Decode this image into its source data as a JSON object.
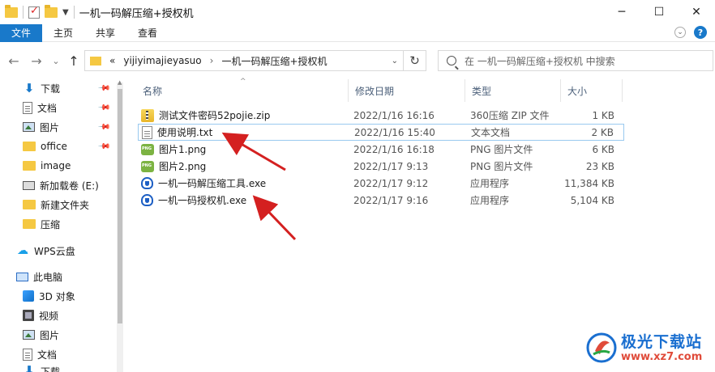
{
  "window": {
    "title": "一机一码解压缩+授权机",
    "controls": {
      "minimize": "─",
      "maximize": "☐",
      "close": "✕"
    }
  },
  "ribbon": {
    "tabs": [
      "文件",
      "主页",
      "共享",
      "查看"
    ],
    "expand": "⌄",
    "help": "?"
  },
  "addressbar": {
    "back": "←",
    "forward": "→",
    "recent": "⌄",
    "up": "↑",
    "overflow": "«",
    "crumbs": [
      "yijiyimajieyasuo",
      "一机一码解压缩+授权机"
    ],
    "separator": "›",
    "dropdown": "⌄",
    "refresh": "↻",
    "search_placeholder": "在 一机一码解压缩+授权机 中搜索"
  },
  "sidebar": {
    "items": [
      {
        "label": "下载",
        "icon": "download-icon",
        "pinned": true
      },
      {
        "label": "文档",
        "icon": "document-icon",
        "pinned": true
      },
      {
        "label": "图片",
        "icon": "picture-icon",
        "pinned": true
      },
      {
        "label": "office",
        "icon": "folder-icon",
        "pinned": true
      },
      {
        "label": "image",
        "icon": "folder-icon",
        "pinned": false
      },
      {
        "label": "新加载卷 (E:)",
        "icon": "drive-icon",
        "pinned": false
      },
      {
        "label": "新建文件夹",
        "icon": "folder-icon",
        "pinned": false
      },
      {
        "label": "压缩",
        "icon": "folder-icon",
        "pinned": false
      },
      {
        "label": "WPS云盘",
        "icon": "cloud-icon",
        "pinned": false
      },
      {
        "label": "此电脑",
        "icon": "computer-icon",
        "pinned": false
      },
      {
        "label": "3D 对象",
        "icon": "3d-objects-icon",
        "pinned": false
      },
      {
        "label": "视频",
        "icon": "video-icon",
        "pinned": false
      },
      {
        "label": "图片",
        "icon": "picture-icon",
        "pinned": false
      },
      {
        "label": "文档",
        "icon": "document-icon",
        "pinned": false
      },
      {
        "label": "下载",
        "icon": "download-icon",
        "pinned": false
      }
    ],
    "pin_glyph": "📌"
  },
  "filelist": {
    "columns": [
      "名称",
      "修改日期",
      "类型",
      "大小"
    ],
    "sort_indicator": "^",
    "files": [
      {
        "name": "测试文件密码52pojie.zip",
        "date": "2022/1/16 16:16",
        "type": "360压缩 ZIP 文件",
        "size": "1 KB",
        "icon": "zip-icon"
      },
      {
        "name": "使用说明.txt",
        "date": "2022/1/16 15:40",
        "type": "文本文档",
        "size": "2 KB",
        "icon": "text-file-icon"
      },
      {
        "name": "图片1.png",
        "date": "2022/1/16 16:18",
        "type": "PNG 图片文件",
        "size": "6 KB",
        "icon": "png-icon"
      },
      {
        "name": "图片2.png",
        "date": "2022/1/17 9:13",
        "type": "PNG 图片文件",
        "size": "23 KB",
        "icon": "png-icon"
      },
      {
        "name": "一机一码解压缩工具.exe",
        "date": "2022/1/17 9:12",
        "type": "应用程序",
        "size": "11,384 KB",
        "icon": "exe-icon"
      },
      {
        "name": "一机一码授权机.exe",
        "date": "2022/1/17 9:16",
        "type": "应用程序",
        "size": "5,104 KB",
        "icon": "exe-icon"
      }
    ]
  },
  "watermark": {
    "title": "极光下载站",
    "url": "www.xz7.com"
  },
  "colors": {
    "accent": "#1979ca",
    "annotation_arrow": "#d42020",
    "selection_border": "#99c9ef",
    "header_text": "#4c607a"
  }
}
